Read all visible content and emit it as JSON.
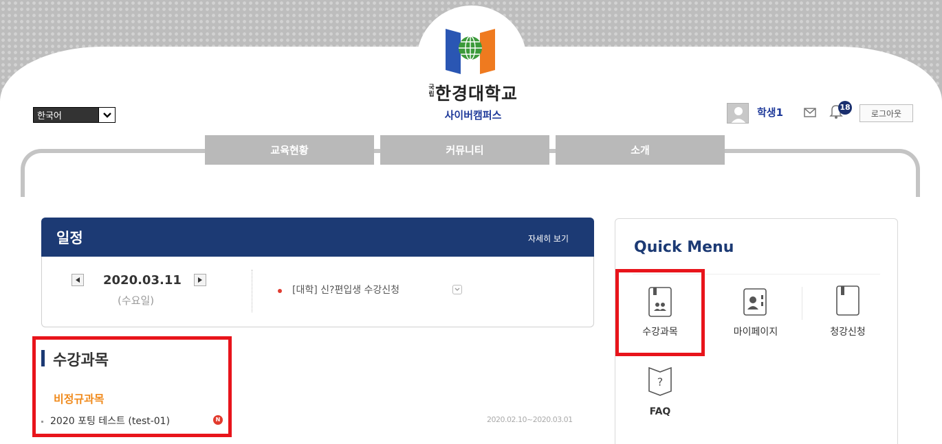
{
  "header": {
    "logo_prefix": "국립",
    "logo_title": "한경대학교",
    "logo_subtitle": "사이버캠퍼스",
    "language": "한국어",
    "user_name": "학생1",
    "notification_count": "18",
    "logout_label": "로그아웃"
  },
  "nav": {
    "tabs": [
      {
        "label": "교육현황"
      },
      {
        "label": "커뮤니티"
      },
      {
        "label": "소개"
      }
    ]
  },
  "schedule": {
    "title": "일정",
    "more_label": "자세히 보기",
    "date": "2020.03.11",
    "day": "(수요일)",
    "event": "[대학] 신?편입생 수강신청"
  },
  "courses": {
    "title": "수강과목",
    "category": "비정규과목",
    "items": [
      {
        "name": "2020 포팅 테스트 (test-01)",
        "badge": "N",
        "period": "2020.02.10~2020.03.01"
      }
    ]
  },
  "quick_menu": {
    "title": "Quick Menu",
    "items": [
      {
        "label": "수강과목",
        "icon": "book-people-icon"
      },
      {
        "label": "마이페이지",
        "icon": "profile-card-icon"
      },
      {
        "label": "청강신청",
        "icon": "bookmark-book-icon"
      },
      {
        "label": "FAQ",
        "icon": "question-book-icon"
      }
    ]
  },
  "colors": {
    "navy": "#1c3a74",
    "brand_blue": "#1f3a9a",
    "orange": "#f08a1c",
    "highlight_red": "#e8141b"
  }
}
